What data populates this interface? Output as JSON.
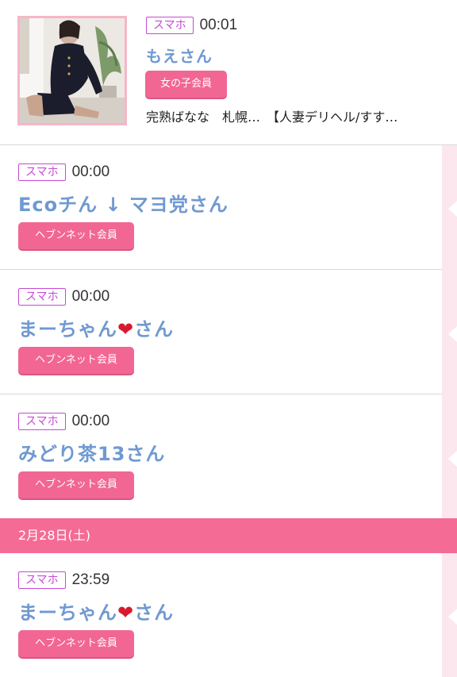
{
  "top_entry": {
    "badge": "スマホ",
    "time": "00:01",
    "name": "もえさん",
    "member_label": "女の子会員",
    "description": "完熟ばなな　札幌…　【人妻デリヘル/すす…"
  },
  "entries": [
    {
      "badge": "スマホ",
      "time": "00:00",
      "name": "Ecoチん ↓ マヨ党さん",
      "member_label": "ヘブンネット会員"
    },
    {
      "badge": "スマホ",
      "time": "00:00",
      "name_prefix": "まーちゃん",
      "name_suffix": "さん",
      "member_label": "ヘブンネット会員"
    },
    {
      "badge": "スマホ",
      "time": "00:00",
      "name": "みどり茶13さん",
      "member_label": "ヘブンネット会員"
    }
  ],
  "date_header": "2月28日(土)",
  "after_date_entries": [
    {
      "badge": "スマホ",
      "time": "23:59",
      "name_prefix": "まーちゃん",
      "name_suffix": "さん",
      "member_label": "ヘブンネット会員"
    }
  ],
  "colors": {
    "accent_pink": "#f46b96",
    "name_blue": "#6f99d2",
    "badge_purple": "#c44bd3",
    "strip_pink": "#fde7ef"
  },
  "icons": {
    "heart": "heart-icon"
  }
}
